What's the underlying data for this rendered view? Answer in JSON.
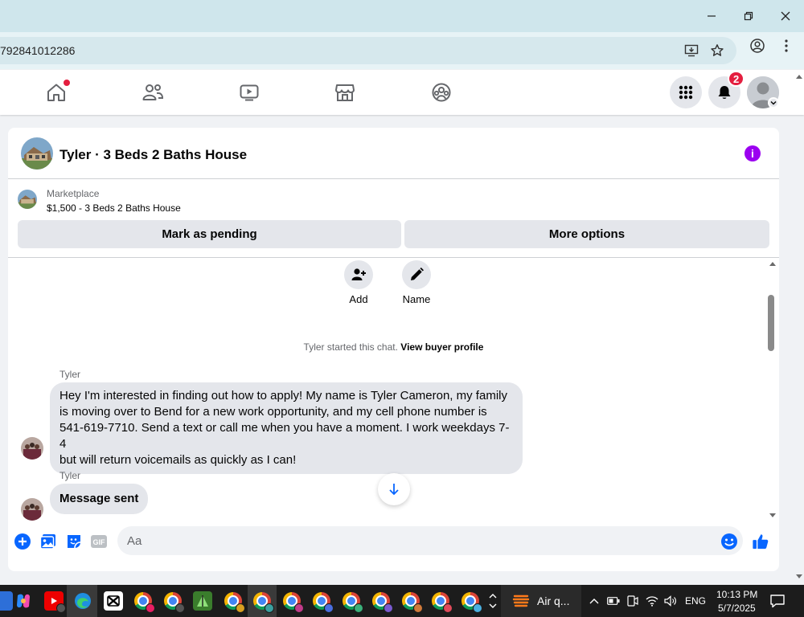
{
  "browser": {
    "url_fragment": "792841012286"
  },
  "fb_nav": {
    "notification_count": "2"
  },
  "chat": {
    "title": "Tyler · 3 Beds 2 Baths House",
    "marketplace_label": "Marketplace",
    "listing": "$1,500 - 3 Beds 2 Baths House",
    "mark_pending_label": "Mark as pending",
    "more_options_label": "More options",
    "actions": [
      {
        "label": "Add"
      },
      {
        "label": "Name"
      }
    ],
    "system_message": "Tyler started this chat.",
    "system_link": "View buyer profile",
    "messages": [
      {
        "sender": "Tyler",
        "lines": [
          "Hey I'm interested in finding out how to apply! My name is Tyler Cameron, my family",
          "is moving over to Bend for a new work opportunity, and my cell phone number is",
          "541-619-7710. Send a text or call me when you have a moment. I work weekdays 7-4",
          "but will return voicemails as quickly as I can!"
        ]
      },
      {
        "sender": "Tyler",
        "lines": [
          "Message sent"
        ]
      }
    ],
    "composer_placeholder": "Aa",
    "gif_label": "GIF"
  },
  "taskbar": {
    "weather_label": "Air q...",
    "language": "ENG",
    "time": "10:13 PM",
    "date": "5/7/2025"
  },
  "colors": {
    "accent": "#0866ff",
    "info": "#9b00f0",
    "badge": "#e41e3f"
  }
}
